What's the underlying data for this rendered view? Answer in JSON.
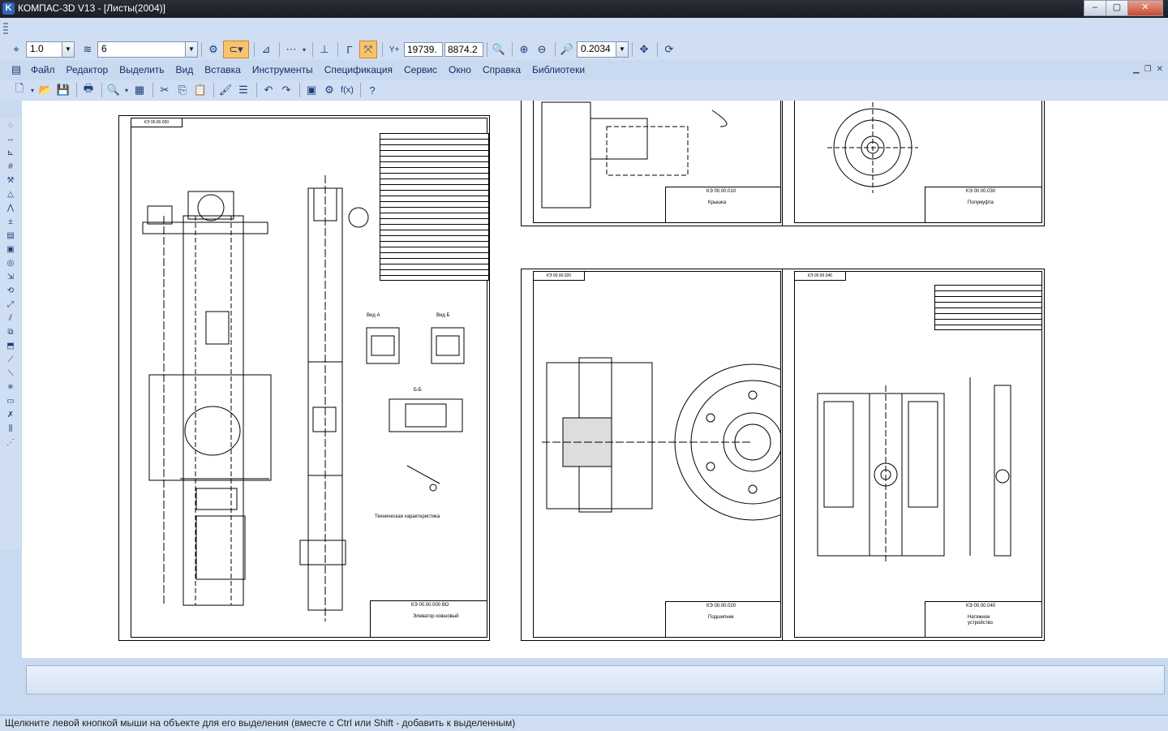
{
  "window": {
    "title": "КОМПАС-3D V13 - [Листы(2004)]",
    "app_icon": "kompas-logo-icon",
    "minimize": "‒",
    "maximize": "▢",
    "close": "✕"
  },
  "toolbar1": {
    "step_value": "1.0",
    "layer_value": "6",
    "x_coord": "19739.",
    "y_coord": "8874.2",
    "zoom_value": "0.2034",
    "xy_label": "Y+",
    "fx_label": "f(x)"
  },
  "menu": {
    "items": [
      "Файл",
      "Редактор",
      "Выделить",
      "Вид",
      "Вставка",
      "Инструменты",
      "Спецификация",
      "Сервис",
      "Окно",
      "Справка",
      "Библиотеки"
    ]
  },
  "status": {
    "hint": "Щелкните левой кнопкой мыши на объекте для его выделения (вместе с Ctrl или Shift - добавить к выделенным)"
  },
  "drawings": {
    "sheet1": {
      "view_a": "Вид А",
      "view_b": "Вид Б",
      "section": "Б-Б",
      "tech_title": "Техническая характеристика",
      "stamp_name": "Элеватор ковшовый",
      "stamp_num": "КЭ 00.00.000 ВО"
    },
    "sheet2": {
      "stamp_name": "Крышка",
      "stamp_num": "КЭ 00.00.010"
    },
    "sheet3": {
      "stamp_name": "Подшипник",
      "stamp_num": "КЭ 00.00.020"
    },
    "sheet4": {
      "stamp_name": "Полумуфта",
      "stamp_num": "КЭ 00.00.030",
      "mark": "√(√)"
    },
    "sheet5": {
      "stamp_name": "Натяжное устройство",
      "stamp_num": "КЭ 00.00.040"
    }
  }
}
